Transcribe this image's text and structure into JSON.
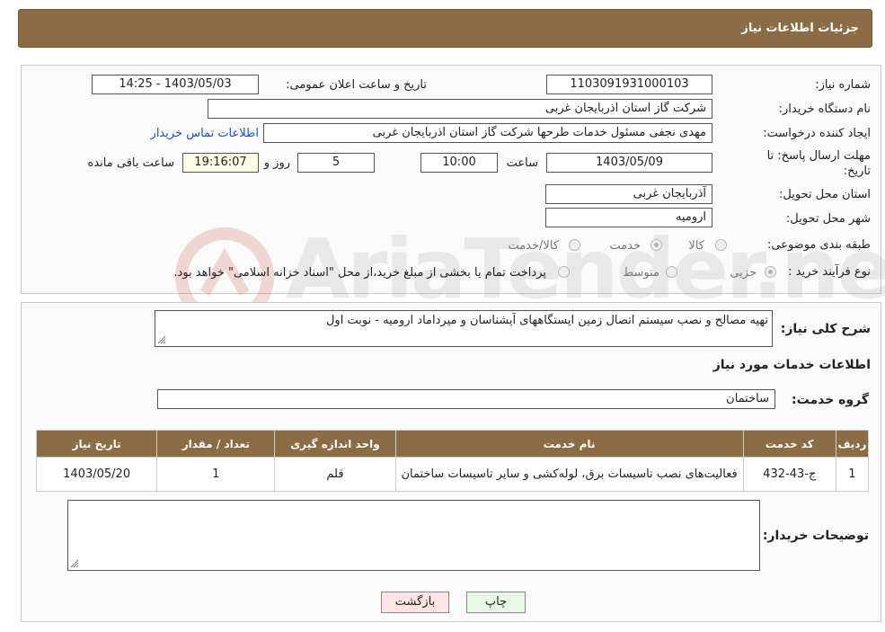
{
  "header": {
    "title": "جزئیات اطلاعات نیاز"
  },
  "fields": {
    "need_number_label": "شماره نیاز:",
    "need_number": "1103091931000103",
    "announce_label": "تاریخ و ساعت اعلان عمومی:",
    "announce_value": "1403/05/03 - 14:25",
    "buyer_org_label": "نام دستگاه خریدار:",
    "buyer_org": "شرکت گاز استان اذربایجان غربی",
    "creator_label": "ایجاد کننده درخواست:",
    "creator": "مهدی نجفی مسئول خدمات طرحها شرکت گاز استان اذربایجان غربی",
    "contact_link": "اطلاعات تماس خریدار",
    "deadline_label": "مهلت ارسال پاسخ: تا تاریخ:",
    "deadline_date": "1403/05/09",
    "time_label": "ساعت",
    "deadline_time": "10:00",
    "days_value": "5",
    "days_label": "روز و",
    "remaining_time": "19:16:07",
    "remaining_label": "ساعت باقی مانده",
    "province_label": "استان محل تحویل:",
    "province": "آذربایجان غربی",
    "city_label": "شهر محل تحویل:",
    "city": "ارومیه",
    "category_label": "طبقه بندی موضوعی:",
    "category_options": [
      "کالا",
      "خدمت",
      "کالا/خدمت"
    ],
    "category_selected": "خدمت",
    "process_label": "نوع فرآیند خرید :",
    "process_options": [
      "جزیی",
      "متوسط"
    ],
    "process_note": "پرداخت تمام یا بخشی از مبلغ خرید،از محل \"اسناد خزانه اسلامی\" خواهد بود."
  },
  "watermark": {
    "text": "AriaTender.neT"
  },
  "description": {
    "label": "شرح کلی نیاز:",
    "value": "تهیه مصالح و نصب سیستم اتصال زمین ایستگاههای آیشناسان و میرداماد ارومیه - نوبت اول"
  },
  "services": {
    "section_title": "اطلاعات خدمات مورد نیاز",
    "group_label": "گروه خدمت:",
    "group_value": "ساختمان",
    "columns": [
      "ردیف",
      "کد خدمت",
      "نام خدمت",
      "واحد اندازه گیری",
      "تعداد / مقدار",
      "تاریخ نیاز"
    ],
    "rows": [
      [
        "1",
        "ج-43-432",
        "فعالیت‌های نصب تاسیسات برق، لوله‌کشی و سایر تاسیسات ساختمان",
        "قلم",
        "1",
        "1403/05/20"
      ]
    ]
  },
  "buyer_notes": {
    "label": "توضیحات خریدار:",
    "value": ""
  },
  "buttons": {
    "return": "بازگشت",
    "print": "چاپ"
  }
}
